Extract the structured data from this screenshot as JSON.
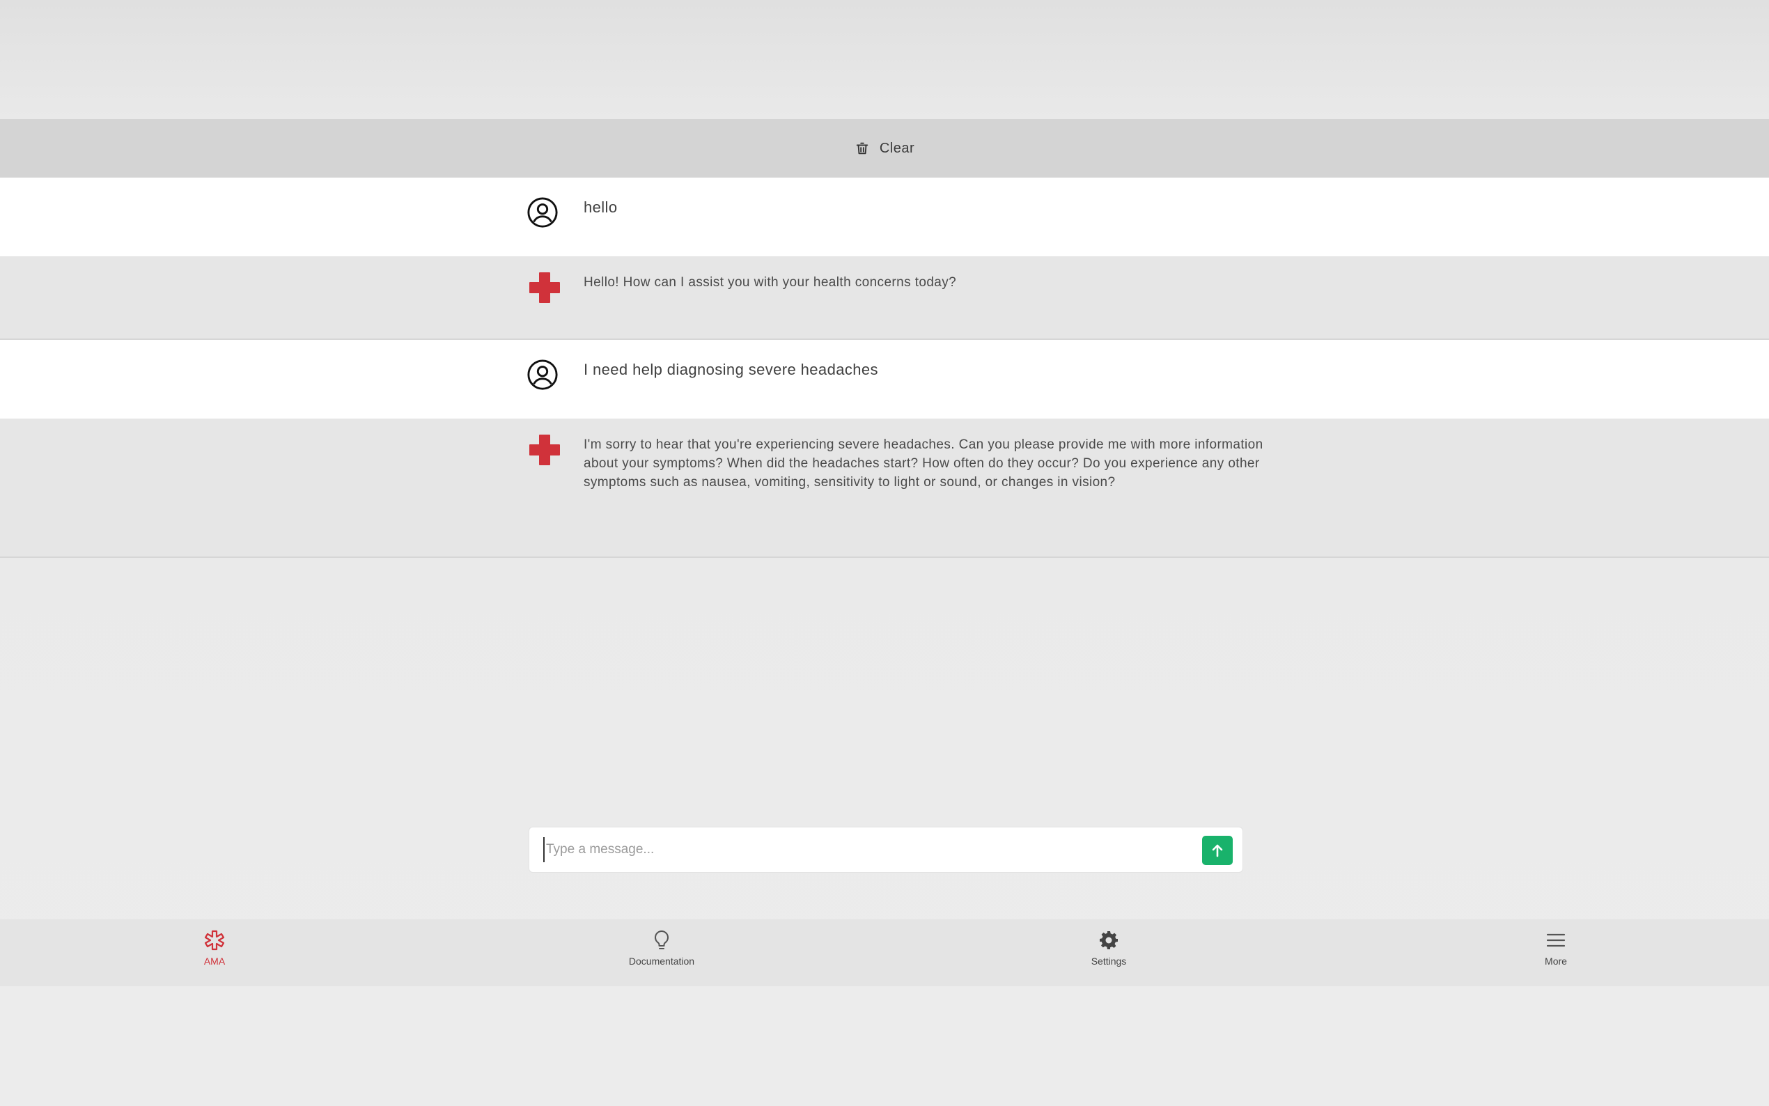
{
  "toolbar": {
    "clear_label": "Clear"
  },
  "messages": [
    {
      "role": "user",
      "text": "hello"
    },
    {
      "role": "bot",
      "text": "Hello! How can I assist you with your health concerns today?"
    },
    {
      "role": "user",
      "text": "I need help diagnosing severe headaches"
    },
    {
      "role": "bot",
      "text": "I'm sorry to hear that you're experiencing severe headaches. Can you please provide me with more information about your symptoms? When did the headaches start? How often do they occur? Do you experience any other symptoms such as nausea, vomiting, sensitivity to light or sound, or changes in vision?"
    }
  ],
  "composer": {
    "placeholder": "Type a message...",
    "value": ""
  },
  "nav": {
    "items": [
      {
        "label": "AMA",
        "icon": "medical-star-icon",
        "active": true
      },
      {
        "label": "Documentation",
        "icon": "lightbulb-icon",
        "active": false
      },
      {
        "label": "Settings",
        "icon": "gear-icon",
        "active": false
      },
      {
        "label": "More",
        "icon": "menu-icon",
        "active": false
      }
    ]
  },
  "colors": {
    "accent_red": "#d0323a",
    "send_green": "#19b26b"
  }
}
